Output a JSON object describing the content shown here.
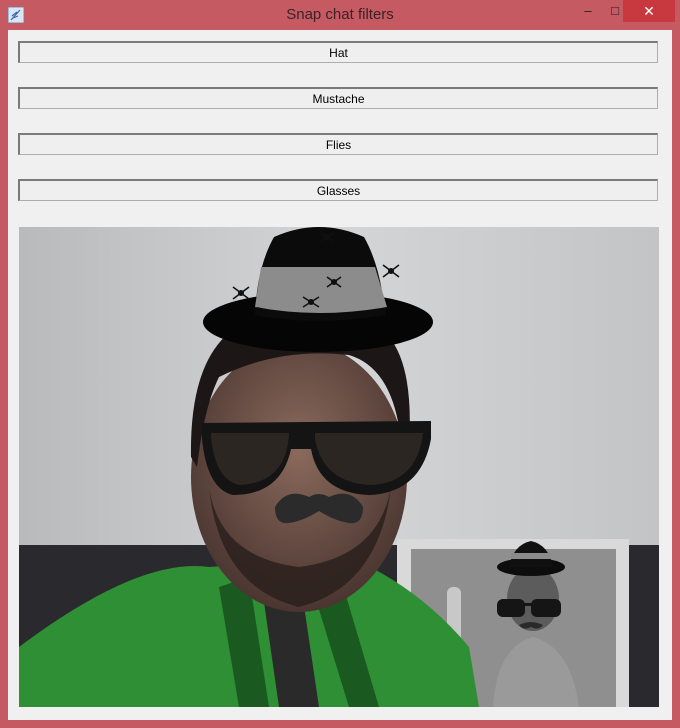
{
  "window": {
    "title": "Snap chat filters",
    "controls": {
      "minimize": "–",
      "maximize": "□",
      "close": "✕"
    }
  },
  "buttons": [
    {
      "label": "Hat"
    },
    {
      "label": "Mustache"
    },
    {
      "label": "Flies"
    },
    {
      "label": "Glasses"
    }
  ],
  "camera": {
    "filters_applied": [
      "hat",
      "flies",
      "glasses",
      "mustache"
    ],
    "accent_colors": {
      "shirt": "#2f8f35",
      "wall": "#c9cacb",
      "frame": "#c65a63"
    }
  }
}
